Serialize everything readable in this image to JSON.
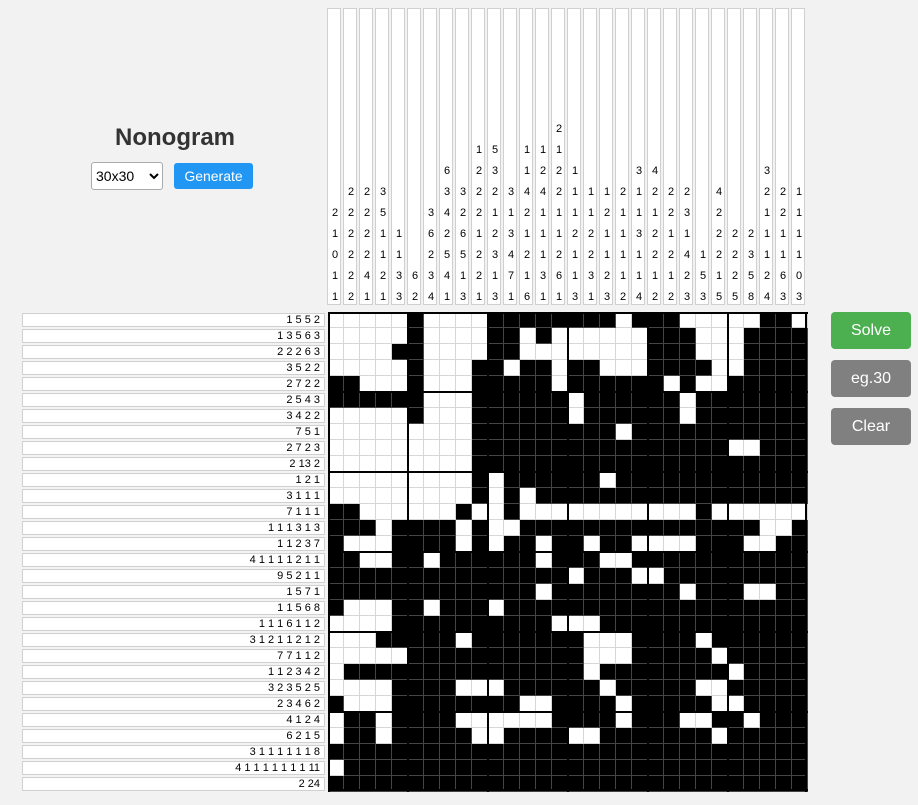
{
  "title": "Nonogram",
  "size_select": {
    "value": "30x30",
    "options": [
      "30x30"
    ]
  },
  "buttons": {
    "generate": "Generate",
    "solve": "Solve",
    "example": "eg.30",
    "clear": "Clear"
  },
  "colors": {
    "generate": "#2196f3",
    "solve": "#4caf50",
    "secondary": "#808080"
  },
  "column_clues": [
    [
      "2",
      "1",
      "0",
      "1",
      "1"
    ],
    [
      "2",
      "2",
      "2",
      "2",
      "2",
      "2"
    ],
    [
      "2",
      "2",
      "2",
      "2",
      "4",
      "1"
    ],
    [
      "3",
      "5",
      "1",
      "1",
      "2",
      "1"
    ],
    [
      "1",
      "1",
      "3",
      "3"
    ],
    [
      "6",
      "2"
    ],
    [
      "3",
      "6",
      "2",
      "3",
      "4"
    ],
    [
      "6",
      "3",
      "4",
      "2",
      "5",
      "4",
      "1"
    ],
    [
      "3",
      "2",
      "6",
      "5",
      "1",
      "3"
    ],
    [
      "1",
      "2",
      "2",
      "2",
      "1",
      "2",
      "2",
      "1"
    ],
    [
      "5",
      "3",
      "2",
      "1",
      "2",
      "3",
      "1",
      "3"
    ],
    [
      "3",
      "1",
      "3",
      "4",
      "7",
      "1"
    ],
    [
      "1",
      "1",
      "4",
      "2",
      "1",
      "2",
      "1",
      "6"
    ],
    [
      "1",
      "2",
      "4",
      "1",
      "1",
      "1",
      "3",
      "1"
    ],
    [
      "2",
      "1",
      "2",
      "2",
      "1",
      "1",
      "2",
      "6",
      "1"
    ],
    [
      "1",
      "1",
      "1",
      "2",
      "1",
      "1",
      "3"
    ],
    [
      "1",
      "1",
      "2",
      "2",
      "3",
      "1"
    ],
    [
      "1",
      "2",
      "1",
      "1",
      "2",
      "3"
    ],
    [
      "2",
      "1",
      "1",
      "1",
      "1",
      "2"
    ],
    [
      "3",
      "1",
      "1",
      "3",
      "1",
      "1",
      "4"
    ],
    [
      "4",
      "2",
      "1",
      "2",
      "2",
      "1",
      "2"
    ],
    [
      "2",
      "2",
      "1",
      "2",
      "1",
      "2"
    ],
    [
      "2",
      "3",
      "1",
      "4",
      "2",
      "3"
    ],
    [
      "1",
      "5",
      "3"
    ],
    [
      "4",
      "2",
      "2",
      "2",
      "1",
      "5"
    ],
    [
      "2",
      "2",
      "2",
      "5"
    ],
    [
      "2",
      "3",
      "5",
      "8"
    ],
    [
      "3",
      "2",
      "1",
      "1",
      "1",
      "2",
      "4"
    ],
    [
      "2",
      "2",
      "1",
      "1",
      "6",
      "3"
    ],
    [
      "1",
      "1",
      "1",
      "1",
      "0",
      "3"
    ]
  ],
  "row_clues": [
    "1 5 5 2",
    "1 3 5 6 3",
    "2 2 2 6 3",
    "3 5 2 2",
    "2 7 2 2",
    "2 5 4 3",
    "3 4 2 2",
    "7 5 1",
    "2 7 2 3",
    "2 13 2",
    "1 2 1",
    "3 1 1 1",
    "7 1 1 1",
    "1 1 1 3 1 3",
    "1 1 2 3 7",
    "4 1 1 1 1 2 1 1",
    "9 5 2 1 1",
    "1 5 7 1",
    "1 1 5 6 8",
    "1 1 1 6 1 1 2",
    "3 1 2 1 1 2 1 2",
    "7 7 1 1 2",
    "1 1 2 3 4 2",
    "3 2 3 5 2 5",
    "2 3 4 6 2",
    "4 1 2 4",
    "6 2 1 5",
    "3 1 1 1 1 1 1 8",
    "4 1 1 1 1 1 1 1 11",
    "2 24"
  ],
  "grid_rows": [
    "000001000011111111011100000110",
    "000001000011010000001110001111",
    "000011000011000000001110001111",
    "000001000110110110001111001111",
    "110001000111110111111010011111",
    "111111000111111011111101111111",
    "000001000111111011111101111111",
    "000000000111111111011111111111",
    "000000000111111111111111100111",
    "000000000111111111111111111111",
    "000000000101111110111111111111",
    "000000000101011111111111111111",
    "110000001001000000000001000000",
    "111011110100111111111111111001",
    "100011110101101101100001110011",
    "110011011111101110011111111111",
    "111111111111111011100111111111",
    "111111111111101111111101110011",
    "100011011101111111111111111111",
    "000011111111110001111111111111",
    "000111110111111100011110111111",
    "000001111111111100011111011111",
    "011111111111111101111111101111",
    "000011110001111110111110011111",
    "100011111111001111011111001111",
    "011011110000001111011100110111",
    "011011111001111001111111011111",
    "111111111111111111111111111111",
    "011111111111111111111111111111",
    "111111111111111111111111111111"
  ]
}
